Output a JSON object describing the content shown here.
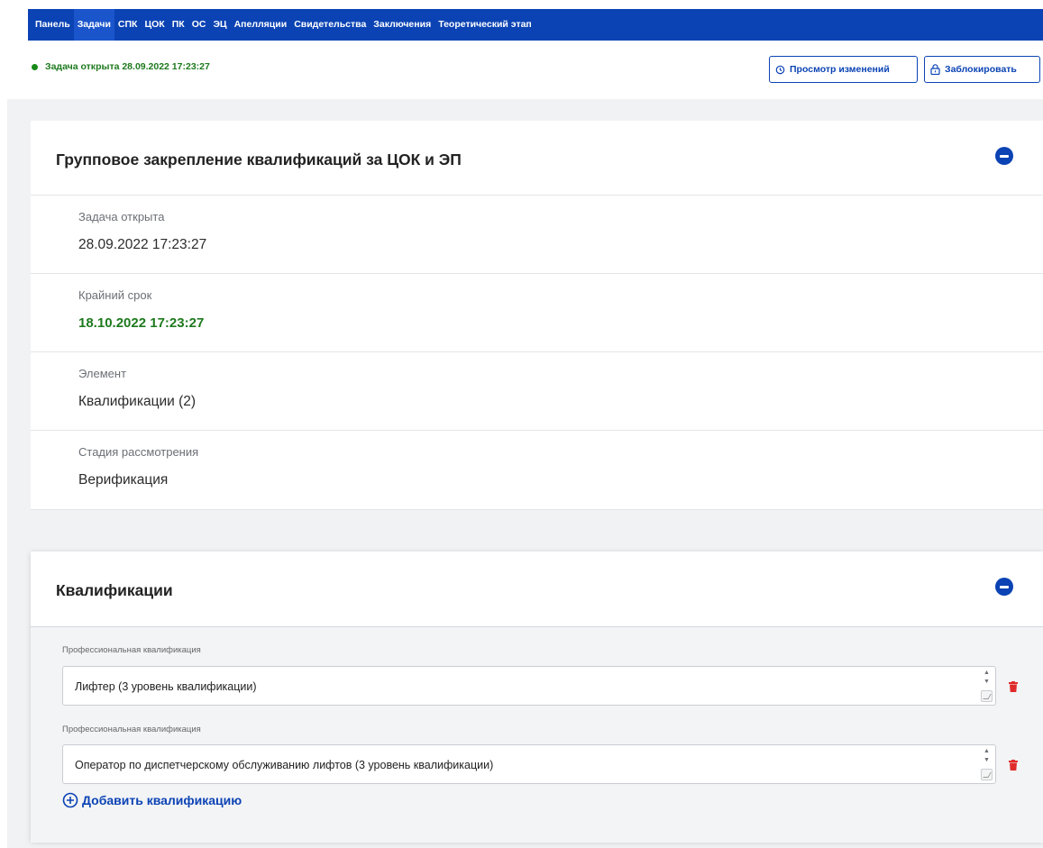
{
  "nav": {
    "items": [
      "Панель",
      "Задачи",
      "СПК",
      "ЦОК",
      "ПК",
      "ОС",
      "ЭЦ",
      "Апелляции",
      "Свидетельства",
      "Заключения",
      "Теоретический этап"
    ],
    "active_index": 1
  },
  "status": {
    "text": "Задача открыта 28.09.2022 17:23:27",
    "color": "#178a17"
  },
  "toolbar": {
    "history_label": "Просмотр изменений",
    "lock_label": "Заблокировать"
  },
  "task_card": {
    "title": "Групповое закрепление квалификаций за ЦОК и ЭП",
    "fields": [
      {
        "label": "Задача открыта",
        "value": "28.09.2022 17:23:27"
      },
      {
        "label": "Крайний срок",
        "value": "18.10.2022 17:23:27"
      },
      {
        "label": "Элемент",
        "value": "Квалификации (2)"
      },
      {
        "label": "Стадия рассмотрения",
        "value": "Верификация"
      }
    ]
  },
  "qual_card": {
    "title": "Квалификации",
    "items": [
      {
        "label": "Профессиональная квалификация",
        "value": "Лифтер  (3 уровень квалификации)"
      },
      {
        "label": "Профессиональная квалификация",
        "value": "Оператор по диспетчерскому обслуживанию лифтов (3 уровень квалификации)"
      }
    ],
    "add_label": "Добавить квалификацию"
  },
  "colors": {
    "primary": "#0b43b4",
    "deadline_green": "#1e7a1e",
    "delete_red": "#e02b2b",
    "page_bg": "#f1f2f4"
  },
  "icons": [
    "history-icon",
    "lock-icon",
    "collapse-icon",
    "spinner-icon",
    "resize-handle-icon",
    "trash-icon",
    "plus-circle-icon"
  ]
}
